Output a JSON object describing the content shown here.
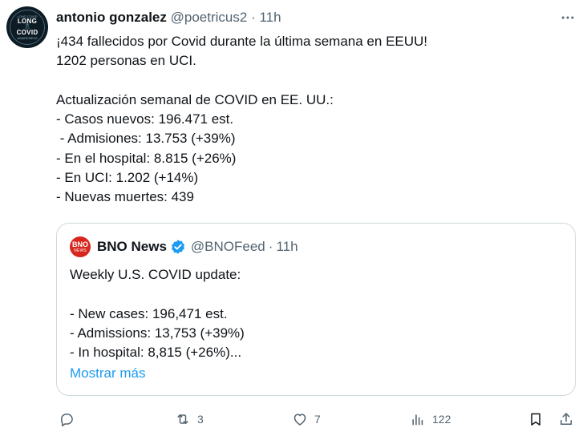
{
  "tweet": {
    "author_name": "antonio gonzalez",
    "handle": "@poetricus2",
    "separator": "·",
    "time": "11h",
    "avatar_text": [
      "LONG",
      "COVID"
    ],
    "avatar_arc_top": "LONG COVID",
    "avatar_arc_bottom": "AWARENESS",
    "lines": [
      "¡434 fallecidos por Covid durante la última semana en EEUU!",
      "1202 personas en UCI.",
      "",
      "Actualización semanal de COVID en EE. UU.:",
      "- Casos nuevos: 196.471 est.",
      " - Admisiones: 13.753 (+39%)",
      "- En el hospital: 8.815 (+26%)",
      "- En UCI: 1.202 (+14%)",
      "- Nuevas muertes: 439"
    ]
  },
  "quote": {
    "author_name": "BNO News",
    "handle": "@BNOFeed",
    "separator": "·",
    "time": "11h",
    "logo_top": "BNO",
    "logo_bottom": "NEWS",
    "verified_color": "#1d9bf0",
    "lines": [
      "Weekly U.S. COVID update:",
      "",
      "- New cases: 196,471 est.",
      "- Admissions: 13,753 (+39%)",
      "- In hospital: 8,815 (+26%)..."
    ],
    "show_more": "Mostrar más"
  },
  "actions": {
    "reply_icon": "reply-icon",
    "retweet_icon": "retweet-icon",
    "retweets": "3",
    "like_icon": "heart-icon",
    "likes": "7",
    "views_icon": "views-icon",
    "views": "122",
    "bookmark_icon": "bookmark-icon",
    "share_icon": "share-icon"
  },
  "colors": {
    "text": "#0f1419",
    "secondary": "#536471",
    "link": "#1d9bf0",
    "border": "#cfd9de",
    "bno_red": "#d7261e"
  }
}
